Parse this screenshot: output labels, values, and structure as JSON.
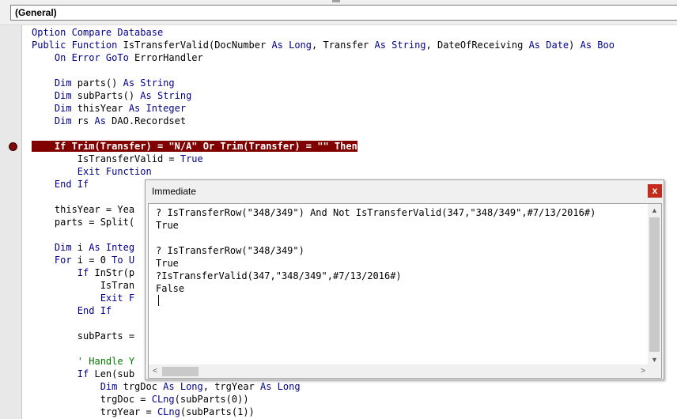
{
  "procedure_dropdown": {
    "value": "(General)"
  },
  "code_lines": [
    [
      [
        "kw",
        "Option Compare Database"
      ]
    ],
    [
      [
        "kw",
        "Public Function "
      ],
      [
        "tx",
        "IsTransferValid(DocNumber "
      ],
      [
        "kw",
        "As Long"
      ],
      [
        "tx",
        ", Transfer "
      ],
      [
        "kw",
        "As String"
      ],
      [
        "tx",
        ", DateOfReceiving "
      ],
      [
        "kw",
        "As Date"
      ],
      [
        "tx",
        ") "
      ],
      [
        "kw",
        "As Boo"
      ]
    ],
    [
      [
        "kw",
        "    On Error GoTo "
      ],
      [
        "tx",
        "ErrorHandler"
      ]
    ],
    [
      [
        "tx",
        ""
      ]
    ],
    [
      [
        "kw",
        "    Dim "
      ],
      [
        "tx",
        "parts() "
      ],
      [
        "kw",
        "As String"
      ]
    ],
    [
      [
        "kw",
        "    Dim "
      ],
      [
        "tx",
        "subParts() "
      ],
      [
        "kw",
        "As String"
      ]
    ],
    [
      [
        "kw",
        "    Dim "
      ],
      [
        "tx",
        "thisYear "
      ],
      [
        "kw",
        "As Integer"
      ]
    ],
    [
      [
        "kw",
        "    Dim "
      ],
      [
        "tx",
        "rs "
      ],
      [
        "kw",
        "As "
      ],
      [
        "tx",
        "DAO.Recordset"
      ]
    ],
    [
      [
        "tx",
        ""
      ]
    ],
    [
      [
        "hl",
        "    If Trim(Transfer) = \"N/A\" Or Trim(Transfer) = \"\" Then"
      ]
    ],
    [
      [
        "tx",
        "        IsTransferValid = "
      ],
      [
        "kw",
        "True"
      ]
    ],
    [
      [
        "kw",
        "        Exit Function"
      ]
    ],
    [
      [
        "kw",
        "    End If"
      ]
    ],
    [
      [
        "tx",
        ""
      ]
    ],
    [
      [
        "tx",
        "    thisYear = Yea"
      ]
    ],
    [
      [
        "tx",
        "    parts = Split("
      ]
    ],
    [
      [
        "tx",
        ""
      ]
    ],
    [
      [
        "kw",
        "    Dim "
      ],
      [
        "tx",
        "i "
      ],
      [
        "kw",
        "As Integ"
      ]
    ],
    [
      [
        "kw",
        "    For "
      ],
      [
        "tx",
        "i = 0 "
      ],
      [
        "kw",
        "To U"
      ]
    ],
    [
      [
        "kw",
        "        If "
      ],
      [
        "tx",
        "InStr(p"
      ]
    ],
    [
      [
        "tx",
        "            IsTran"
      ]
    ],
    [
      [
        "kw",
        "            Exit F"
      ]
    ],
    [
      [
        "kw",
        "        End If"
      ]
    ],
    [
      [
        "tx",
        ""
      ]
    ],
    [
      [
        "tx",
        "        subParts ="
      ]
    ],
    [
      [
        "tx",
        ""
      ]
    ],
    [
      [
        "cm",
        "        ' Handle Y"
      ]
    ],
    [
      [
        "kw",
        "        If "
      ],
      [
        "tx",
        "Len(sub"
      ]
    ],
    [
      [
        "kw",
        "            Dim "
      ],
      [
        "tx",
        "trgDoc "
      ],
      [
        "kw",
        "As Long"
      ],
      [
        "tx",
        ", trgYear "
      ],
      [
        "kw",
        "As Long"
      ]
    ],
    [
      [
        "tx",
        "            trgDoc = "
      ],
      [
        "kw",
        "CLng"
      ],
      [
        "tx",
        "(subParts(0))"
      ]
    ],
    [
      [
        "tx",
        "            trgYear = "
      ],
      [
        "kw",
        "CLng"
      ],
      [
        "tx",
        "(subParts(1))"
      ]
    ]
  ],
  "immediate": {
    "title": "Immediate",
    "close_label": "x",
    "lines": [
      "? IsTransferRow(\"348/349\") And Not IsTransferValid(347,\"348/349\",#7/13/2016#)",
      "True",
      "",
      "? IsTransferRow(\"348/349\")",
      "True",
      "?IsTransferValid(347,\"348/349\",#7/13/2016#)",
      "False"
    ],
    "scroll_up": "▲",
    "scroll_down": "▼",
    "scroll_left": "<",
    "scroll_right": ">"
  }
}
